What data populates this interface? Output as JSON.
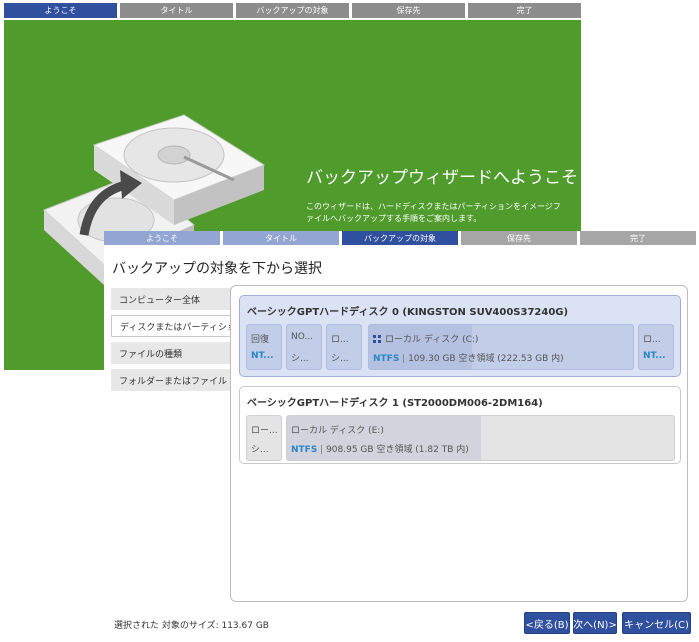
{
  "back_window": {
    "steps": [
      {
        "label": "ようこそ",
        "active": true
      },
      {
        "label": "タイトル",
        "active": false
      },
      {
        "label": "バックアップの対象",
        "active": false
      },
      {
        "label": "保存先",
        "active": false
      },
      {
        "label": "完了",
        "active": false
      }
    ],
    "welcome_title": "バックアップウィザードへようこそ",
    "welcome_description": "このウィザードは、ハードディスクまたはパーティションをイメージファイルへバックアップする手順をご案内します。"
  },
  "front_window": {
    "steps": [
      {
        "label": "ようこそ",
        "state": "done"
      },
      {
        "label": "タイトル",
        "state": "done"
      },
      {
        "label": "バックアップの対象",
        "state": "active"
      },
      {
        "label": "保存先",
        "state": "pending"
      },
      {
        "label": "完了",
        "state": "pending"
      }
    ],
    "title": "バックアップの対象を下から選択",
    "sidebar": [
      {
        "label": "コンピューター全体",
        "selected": false
      },
      {
        "label": "ディスクまたはパーティション",
        "selected": true
      },
      {
        "label": "ファイルの種類",
        "selected": false
      },
      {
        "label": "フォルダーまたはファイル",
        "selected": false
      }
    ],
    "disks": [
      {
        "title": "ベーシックGPTハードディスク 0 (KINGSTON SUV400S37240G)",
        "selected": true,
        "partitions": [
          {
            "name": "回復",
            "detail": "NT..."
          },
          {
            "name": "NO...",
            "detail": "シ..."
          },
          {
            "name": "ロ...",
            "detail": "シ..."
          },
          {
            "name": "ローカル ディスク (C:)",
            "fs": "NTFS",
            "free": "109.30 GB 空き領域 (222.53 GB 内)",
            "used_fraction": 0.39
          },
          {
            "name": "ロ...",
            "detail": "NT..."
          }
        ]
      },
      {
        "title": "ベーシックGPTハードディスク 1 (ST2000DM006-2DM164)",
        "selected": false,
        "partitions": [
          {
            "name": "ロー...",
            "detail": "シ..."
          },
          {
            "name": "ローカル ディスク (E:)",
            "fs": "NTFS",
            "free": "908.95 GB 空き領域 (1.82 TB 内)",
            "used_fraction": 0.5
          }
        ]
      }
    ],
    "status_label": "選択された 対象のサイズ: 113.67 GB",
    "buttons": {
      "back": "<戻る(B)",
      "next": "次へ(N)>",
      "cancel": "キャンセル(C)"
    }
  },
  "colors": {
    "accent": "#2f4f9f",
    "welcome_bg": "#4f9b2c",
    "fs_text": "#2b86c6"
  }
}
